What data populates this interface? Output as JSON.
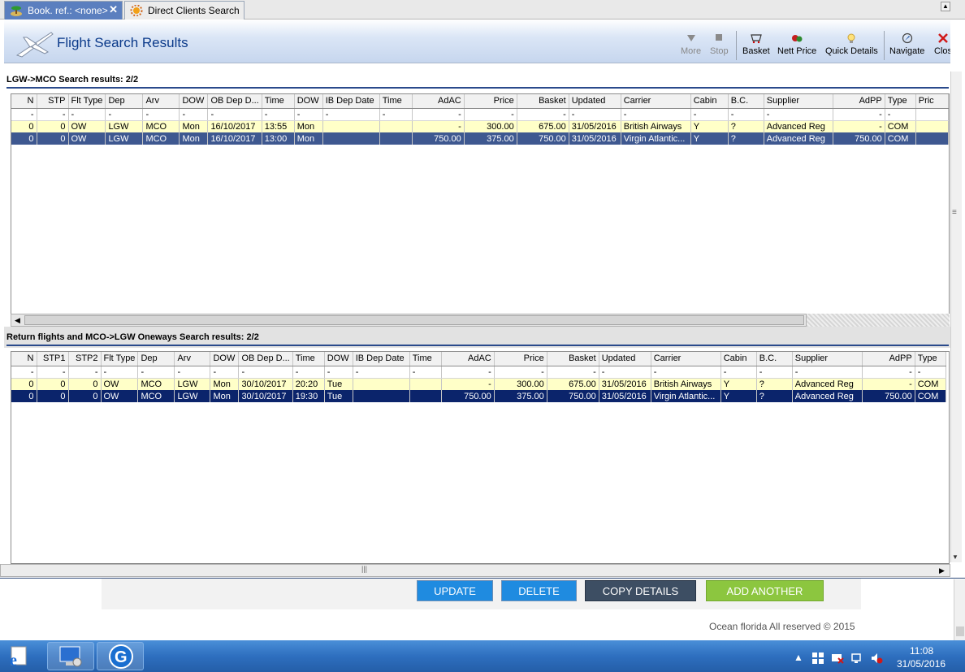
{
  "tabs": [
    {
      "label": "Book. ref.: <none>",
      "close": "✕"
    },
    {
      "label": "Direct Clients Search"
    }
  ],
  "header": {
    "title": "Flight Search Results",
    "toolbar": [
      "More",
      "Stop",
      "Basket",
      "Nett Price",
      "Quick Details",
      "Navigate",
      "Clos"
    ]
  },
  "outbound": {
    "title": "LGW->MCO Search results: 2/2",
    "columns": [
      "N",
      "STP",
      "Flt Type",
      "Dep",
      "Arv",
      "DOW",
      "OB Dep D...",
      "Time",
      "DOW",
      "IB Dep Date",
      "Time",
      "AdAC",
      "Price",
      "Basket",
      "Updated",
      "Carrier",
      "Cabin",
      "B.C.",
      "Supplier",
      "AdPP",
      "Type",
      "Pric"
    ],
    "filter": [
      "-",
      "-",
      "-",
      "-",
      "-",
      "-",
      "-",
      "-",
      "-",
      "-",
      "-",
      "-",
      "-",
      "-",
      "-",
      "-",
      "-",
      "-",
      "-",
      "-",
      "-",
      ""
    ],
    "rows": [
      [
        "0",
        "0",
        "OW",
        "LGW",
        "MCO",
        "Mon",
        "16/10/2017",
        "13:55",
        "Mon",
        "",
        "",
        "-",
        "300.00",
        "675.00",
        "31/05/2016",
        "British Airways",
        "Y",
        "?",
        "Advanced Reg",
        "-",
        "COM",
        ""
      ],
      [
        "0",
        "0",
        "OW",
        "LGW",
        "MCO",
        "Mon",
        "16/10/2017",
        "13:00",
        "Mon",
        "",
        "",
        "750.00",
        "375.00",
        "750.00",
        "31/05/2016",
        "Virgin Atlantic...",
        "Y",
        "?",
        "Advanced Reg",
        "750.00",
        "COM",
        ""
      ]
    ]
  },
  "returns": {
    "title": "Return flights and MCO->LGW Oneways Search results: 2/2",
    "columns": [
      "N",
      "STP1",
      "STP2",
      "Flt Type",
      "Dep",
      "Arv",
      "DOW",
      "OB Dep D...",
      "Time",
      "DOW",
      "IB Dep Date",
      "Time",
      "AdAC",
      "Price",
      "Basket",
      "Updated",
      "Carrier",
      "Cabin",
      "B.C.",
      "Supplier",
      "AdPP",
      "Type"
    ],
    "filter": [
      "-",
      "-",
      "-",
      "-",
      "-",
      "-",
      "-",
      "-",
      "-",
      "-",
      "-",
      "-",
      "-",
      "-",
      "-",
      "-",
      "-",
      "-",
      "-",
      "-",
      "-",
      "-"
    ],
    "rows": [
      [
        "0",
        "0",
        "0",
        "OW",
        "MCO",
        "LGW",
        "Mon",
        "30/10/2017",
        "20:20",
        "Tue",
        "",
        "",
        "-",
        "300.00",
        "675.00",
        "31/05/2016",
        "British Airways",
        "Y",
        "?",
        "Advanced Reg",
        "-",
        "COM"
      ],
      [
        "0",
        "0",
        "0",
        "OW",
        "MCO",
        "LGW",
        "Mon",
        "30/10/2017",
        "19:30",
        "Tue",
        "",
        "",
        "750.00",
        "375.00",
        "750.00",
        "31/05/2016",
        "Virgin Atlantic...",
        "Y",
        "?",
        "Advanced Reg",
        "750.00",
        "COM"
      ]
    ]
  },
  "actions": {
    "update": "UPDATE",
    "delete": "DELETE",
    "copy": "COPY DETAILS",
    "add": "ADD ANOTHER"
  },
  "footer": "Ocean florida All reserved © 2015",
  "taskbar": {
    "time": "11:08",
    "date": "31/05/2016"
  },
  "colors": {
    "row_yellow": "#ffffc8",
    "row_selected_1": "#3e5890",
    "row_selected_2": "#0b246b",
    "update_btn": "#1f8be0",
    "delete_btn": "#1f8be0",
    "copy_btn": "#3d4e63",
    "add_btn": "#8cc63f",
    "tab_active": "#5b7fbf",
    "title_blue": "#0b3a8a"
  },
  "icons": {
    "tab1": "island-icon",
    "tab2": "sun-icon",
    "header": "airplane-icon",
    "more": "triangle-down-icon",
    "stop": "stop-icon",
    "basket": "basket-icon",
    "nett_price": "price-tag-icon",
    "quick_details": "lightbulb-icon",
    "navigate": "compass-icon",
    "close": "close-icon"
  }
}
